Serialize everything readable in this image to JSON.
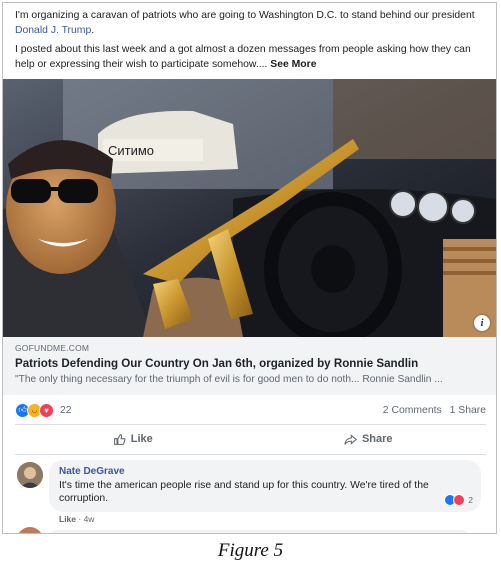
{
  "post": {
    "text_line1_before": "I'm organizing a caravan of patriots who are going to Washington D.C. to stand behind our president ",
    "mention": "Donald J. Trump",
    "text_line1_after": ".",
    "text_line2": "I posted about this last week and a got almost a dozen messages from people asking how they can help or expressing their wish to participate somehow.... ",
    "see_more": "See More"
  },
  "media": {
    "car_sign": "Ситимо",
    "info_glyph": "i"
  },
  "link": {
    "domain": "GOFUNDME.COM",
    "title": "Patriots Defending Our Country On Jan 6th, organized by Ronnie Sandlin",
    "description": "\"The only thing necessary for the triumph of evil is for good men to do noth... Ronnie Sandlin ..."
  },
  "stats": {
    "reaction_icons": [
      "like-icon",
      "haha-icon",
      "love-icon"
    ],
    "reaction_count": "22",
    "comments": "2 Comments",
    "shares": "1 Share"
  },
  "actions": {
    "like_label": "Like",
    "share_label": "Share"
  },
  "comment": {
    "name": "Nate DeGrave",
    "text": "It's time the american people rise and stand up for this country. We're tired of the corruption.",
    "reaction_count": "2",
    "like_label": "Like",
    "separator": " · ",
    "time": "4w"
  },
  "caption": "Figure 5",
  "colors": {
    "link_blue": "#385898",
    "like_blue": "#1877f2",
    "love_red": "#f33e58",
    "haha_yellow": "#f7b125",
    "card_gray": "#f2f3f5"
  }
}
